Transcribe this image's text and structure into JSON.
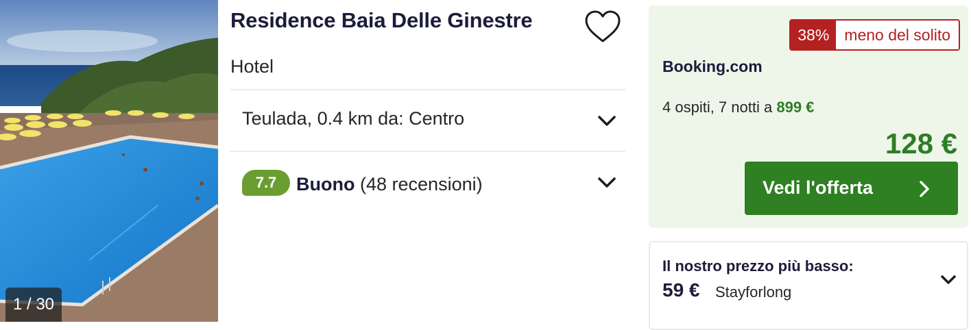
{
  "gallery": {
    "counter": "1 / 30"
  },
  "hotel": {
    "name": "Residence Baia Delle Ginestre",
    "type": "Hotel",
    "location": "Teulada, 0.4 km da: Centro",
    "rating": {
      "score": "7.7",
      "label": "Buono",
      "reviews": "(48 recensioni)"
    }
  },
  "deal": {
    "discount_pct": "38%",
    "discount_text": "meno del solito",
    "provider": "Booking.com",
    "stay_text": "4 ospiti, 7 notti a",
    "stay_total": "899 €",
    "price": "128 €",
    "cta_label": "Vedi l'offerta"
  },
  "lowest": {
    "label": "Il nostro prezzo più basso:",
    "price": "59 €",
    "provider": "Stayforlong"
  },
  "icons": {
    "favorite": "heart-icon",
    "expand": "chevron-down-icon",
    "cta": "chevron-right-icon"
  },
  "colors": {
    "accent_green": "#2f7f23",
    "price_green": "#2e7d26",
    "rating_green": "#6a9e31",
    "discount_red": "#b32121",
    "deal_bg": "#eef6ea"
  }
}
